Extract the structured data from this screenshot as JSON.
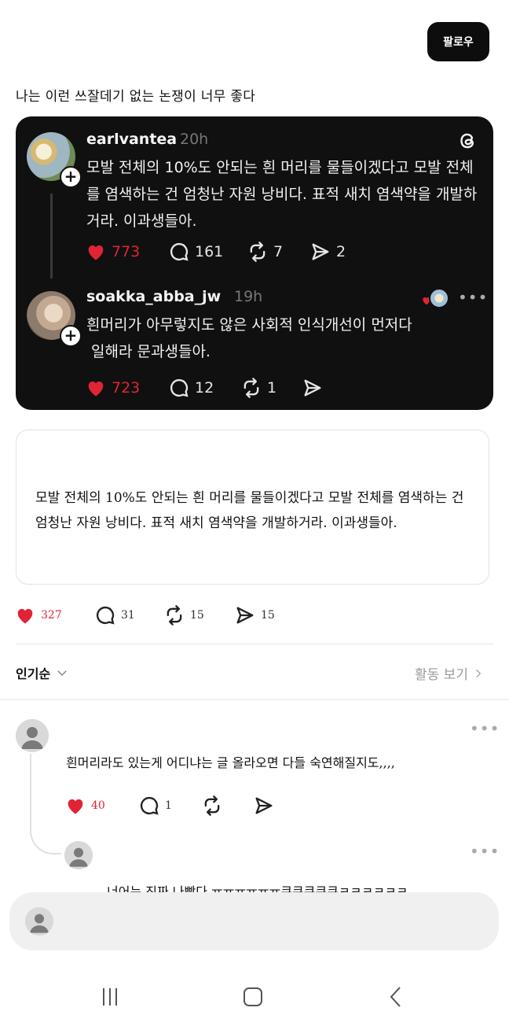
{
  "header": {
    "follow_label": "팔로우"
  },
  "post": {
    "caption": "나는 이런 쓰잘데기 없는 논쟁이 너무 좋다",
    "embedded": {
      "first": {
        "username": "earlvantea",
        "time": "20h",
        "text": "모발 전체의 10%도 안되는 흰 머리를 물들이겠다고 모발 전체를 염색하는 건 엄청난 자원 낭비다. 표적 새치 염색약을 개발하거라. 이과생들아.",
        "likes": "773",
        "replies": "161",
        "reposts": "7",
        "shares": "2"
      },
      "second": {
        "username": "soakka_abba_jw",
        "time": "19h",
        "text_line1": "흰머리가 아무렇지도 않은 사회적 인식개선이 먼저다",
        "text_line2": " 일해라 문과생들아.",
        "likes": "723",
        "replies": "12",
        "reposts": "1",
        "more": "•••"
      }
    },
    "quote_text": "모발 전체의 10%도 안되는 흰 머리를 물들이겠다고 모발 전체를 염색하는 건 엄청난 자원 낭비다. 표적 새치 염색약을 개발하거라. 이과생들아.",
    "stats": {
      "likes": "327",
      "replies": "31",
      "reposts": "15",
      "shares": "15"
    }
  },
  "comments_header": {
    "sort_label": "인기순",
    "activity_label": "활동 보기"
  },
  "comments": [
    {
      "text": "흰머리라도 있는게 어디냐는 글 올라오면 다들 숙연해질지도,,,,",
      "likes": "40",
      "replies": "1",
      "more": "•••"
    },
    {
      "text": "너어는 진짜 나빴다 ㅠㅠㅠㅠㅠㅠ큐큐큐큐큐ㅋㅋㅋㅋㅋㅋ",
      "more": "•••"
    }
  ],
  "colors": {
    "heart": "#e02434",
    "dark_card": "#101010",
    "accent_text": "#ffffff"
  },
  "icons": [
    "heart-icon",
    "reply-icon",
    "repost-icon",
    "share-icon",
    "threads-logo-icon",
    "chevron-down-icon",
    "chevron-right-icon",
    "default-avatar-icon",
    "recent-apps-icon",
    "home-icon",
    "back-icon"
  ]
}
